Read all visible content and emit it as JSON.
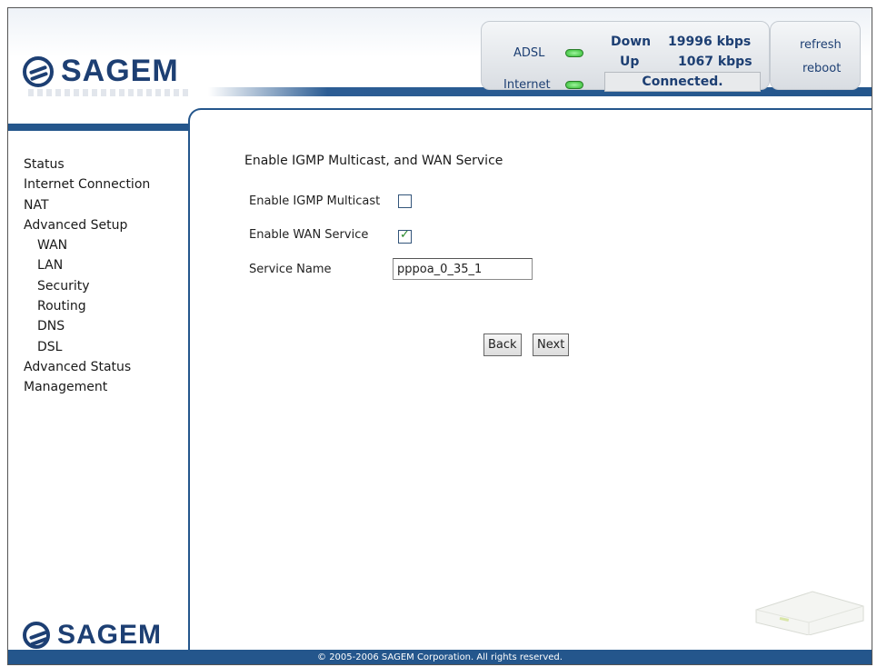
{
  "header": {
    "logo_text": "SAGEM",
    "adsl_label": "ADSL",
    "internet_label": "Internet",
    "down_label": "Down",
    "down_rate": "19996 kbps",
    "up_label": "Up",
    "up_rate": "1067 kbps",
    "connection_status": "Connected.",
    "refresh_label": "refresh",
    "reboot_label": "reboot"
  },
  "sidebar": {
    "items": [
      {
        "label": "Status"
      },
      {
        "label": "Internet Connection"
      },
      {
        "label": "NAT"
      },
      {
        "label": "Advanced Setup"
      },
      {
        "label": "WAN"
      },
      {
        "label": "LAN"
      },
      {
        "label": "Security"
      },
      {
        "label": "Routing"
      },
      {
        "label": "DNS"
      },
      {
        "label": "DSL"
      },
      {
        "label": "Advanced Status"
      },
      {
        "label": "Management"
      }
    ],
    "logo_text": "SAGEM"
  },
  "main": {
    "heading": "Enable IGMP Multicast, and WAN Service",
    "igmp_label": "Enable IGMP Multicast",
    "igmp_checked": false,
    "wan_label": "Enable WAN Service",
    "wan_checked": true,
    "service_name_label": "Service Name",
    "service_name_value": "pppoa_0_35_1",
    "back_label": "Back",
    "next_label": "Next"
  },
  "footer": {
    "copyright": "© 2005-2006 SAGEM Corporation. All rights reserved."
  },
  "colors": {
    "brand_blue": "#24568c",
    "logo_blue": "#1d3f73",
    "led_green": "#2eb82e"
  },
  "icons": [
    "sagem-logo-icon",
    "adsl-led-icon",
    "internet-led-icon",
    "checkbox-icon",
    "router-device-image"
  ]
}
